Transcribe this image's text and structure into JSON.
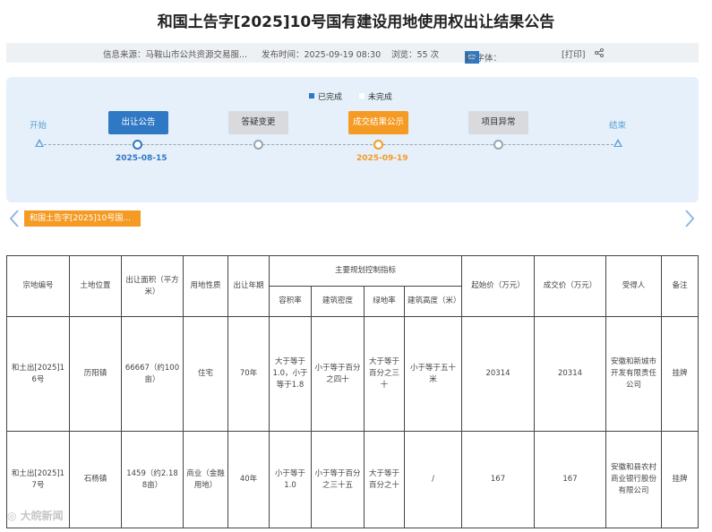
{
  "title": "和国土告字[2025]10号国有建设用地使用权出让结果公告",
  "info": {
    "source": "信息来源：马鞍山市公共资源交易服...",
    "publish_time": "发布时间：2025-09-19 08:30",
    "views": "浏览：55 次",
    "font_label_open": "【 字体：",
    "font_large": "大",
    "font_medium": "中",
    "font_small": "小",
    "font_label_close": "】",
    "print": "[打印]",
    "share_icon": "share-icon"
  },
  "timeline": {
    "legend_done": "已完成",
    "legend_todo": "未完成",
    "colors": {
      "done": "#2f78c4",
      "todo": "#d8dadd",
      "current": "#f59a23"
    },
    "start": "开始",
    "end": "结束",
    "steps": [
      {
        "label": "出让公告",
        "date": "2025-08-15",
        "status": "done"
      },
      {
        "label": "答疑变更",
        "date": "",
        "status": "todo"
      },
      {
        "label": "成交结果公示",
        "date": "2025-09-19",
        "status": "current"
      },
      {
        "label": "项目异常",
        "date": "",
        "status": "todo"
      }
    ]
  },
  "tab": {
    "label": "和国土告字[2025]10号国..."
  },
  "table": {
    "headers": {
      "parcel_no": "宗地编号",
      "location": "土地位置",
      "area": "出让面积（平方米）",
      "use": "用地性质",
      "term": "出让年期",
      "indicators": "主要规划控制指标",
      "far": "容积率",
      "density": "建筑密度",
      "green": "绿地率",
      "height": "建筑高度（米）",
      "start_price": "起始价（万元）",
      "deal_price": "成交价（万元）",
      "winner": "受得人",
      "remark": "备注"
    },
    "rows": [
      {
        "parcel_no": "和土出[2025]16号",
        "location": "历阳镇",
        "area": "66667（约100亩）",
        "use": "住宅",
        "term": "70年",
        "far": "大于等于1.0，小于等于1.8",
        "density": "小于等于百分之四十",
        "green": "大于等于百分之三十",
        "height": "小于等于五十米",
        "start_price": "20314",
        "deal_price": "20314",
        "winner": "安徽和新城市开发有限责任公司",
        "remark": "挂牌"
      },
      {
        "parcel_no": "和土出[2025]17号",
        "location": "石杨镇",
        "area": "1459（约2.188亩）",
        "use": "商业（金融用地）",
        "term": "40年",
        "far": "小于等于1.0",
        "density": "小于等于百分之三十五",
        "green": "大于等于百分之十",
        "height": "/",
        "start_price": "167",
        "deal_price": "167",
        "winner": "安徽和县农村商业银行股份有限公司",
        "remark": "挂牌"
      }
    ]
  },
  "watermark": "大皖新闻"
}
